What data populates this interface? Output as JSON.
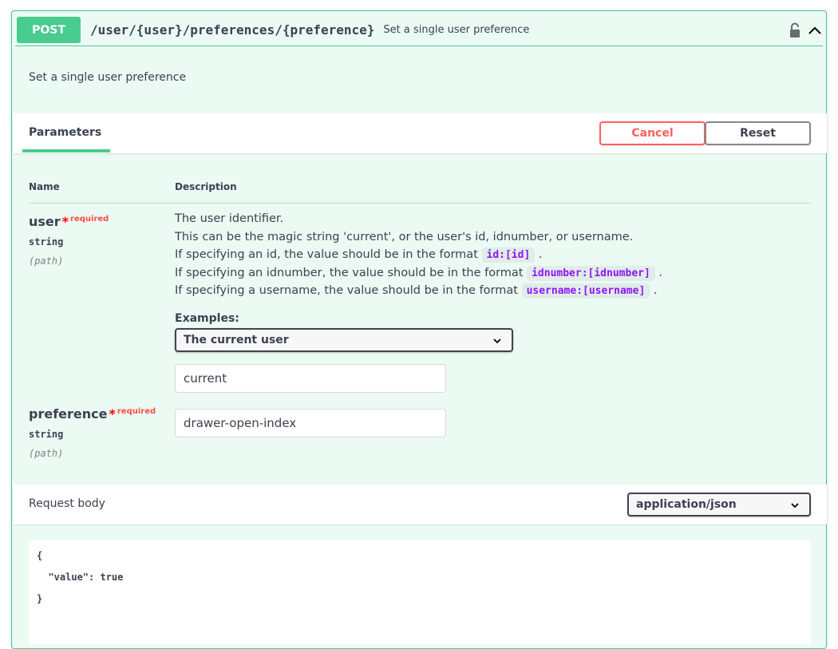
{
  "summary": {
    "method": "POST",
    "path": "/user/{user}/preferences/{preference}",
    "description": "Set a single user preference"
  },
  "operation_description": "Set a single user preference",
  "params_section": {
    "tab_label": "Parameters",
    "cancel_label": "Cancel",
    "reset_label": "Reset",
    "col_name": "Name",
    "col_description": "Description"
  },
  "params": [
    {
      "name": "user",
      "star": "*",
      "required_label": "required",
      "type": "string",
      "in": "(path)",
      "description": {
        "line1": "The user identifier.",
        "line2": "This can be the magic string 'current', or the user's id, idnumber, or username.",
        "line3_text": "If specifying an id, the value should be in the format",
        "line3_code": "id:[id]",
        "line4_text": "If specifying an idnumber, the value should be in the format",
        "line4_code": "idnumber:[idnumber]",
        "line5_text": "If specifying a username, the value should be in the format",
        "line5_code": "username:[username]",
        "period": "."
      },
      "examples_label": "Examples:",
      "examples_selected": "The current user",
      "value": "current"
    },
    {
      "name": "preference",
      "star": "*",
      "required_label": "required",
      "type": "string",
      "in": "(path)",
      "value": "drawer-open-index"
    }
  ],
  "request_body": {
    "label": "Request body",
    "content_type": "application/json",
    "code_lines": [
      "{",
      "  \"value\": true",
      "}"
    ]
  },
  "colors": {
    "post_accent": "#49cc90",
    "cancel": "#ff6060",
    "code": "#9012fe"
  }
}
